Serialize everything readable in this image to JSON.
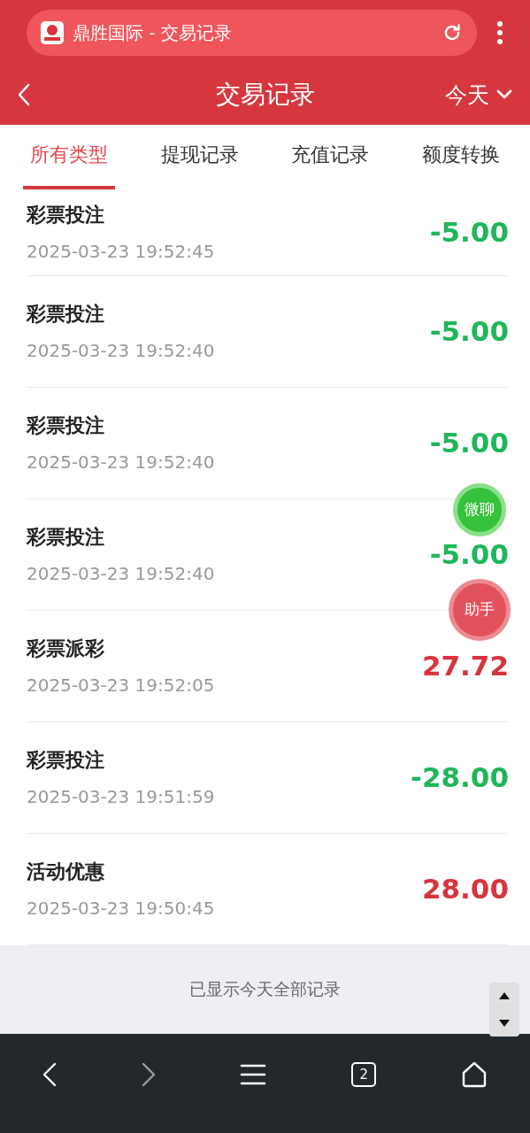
{
  "browser": {
    "page_title": "鼎胜国际 - 交易记录"
  },
  "header": {
    "title": "交易记录",
    "period": "今天"
  },
  "tabs": [
    {
      "label": "所有类型",
      "selected": true
    },
    {
      "label": "提现记录",
      "selected": false
    },
    {
      "label": "充值记录",
      "selected": false
    },
    {
      "label": "额度转换",
      "selected": false
    }
  ],
  "records": [
    {
      "type": "彩票投注",
      "time": "2025-03-23 19:52:45",
      "amount": "-5.00",
      "kind": "debit"
    },
    {
      "type": "彩票投注",
      "time": "2025-03-23 19:52:40",
      "amount": "-5.00",
      "kind": "debit"
    },
    {
      "type": "彩票投注",
      "time": "2025-03-23 19:52:40",
      "amount": "-5.00",
      "kind": "debit"
    },
    {
      "type": "彩票投注",
      "time": "2025-03-23 19:52:40",
      "amount": "-5.00",
      "kind": "debit"
    },
    {
      "type": "彩票派彩",
      "time": "2025-03-23 19:52:05",
      "amount": "27.72",
      "kind": "credit"
    },
    {
      "type": "彩票投注",
      "time": "2025-03-23 19:51:59",
      "amount": "-28.00",
      "kind": "debit"
    },
    {
      "type": "活动优惠",
      "time": "2025-03-23 19:50:45",
      "amount": "28.00",
      "kind": "credit"
    }
  ],
  "floating_buttons": [
    {
      "label": "微聊",
      "kind": "chat"
    },
    {
      "label": "助手",
      "kind": "assistant"
    }
  ],
  "footer": {
    "message": "已显示今天全部记录"
  },
  "browser_nav": {
    "tab_count": "2"
  }
}
